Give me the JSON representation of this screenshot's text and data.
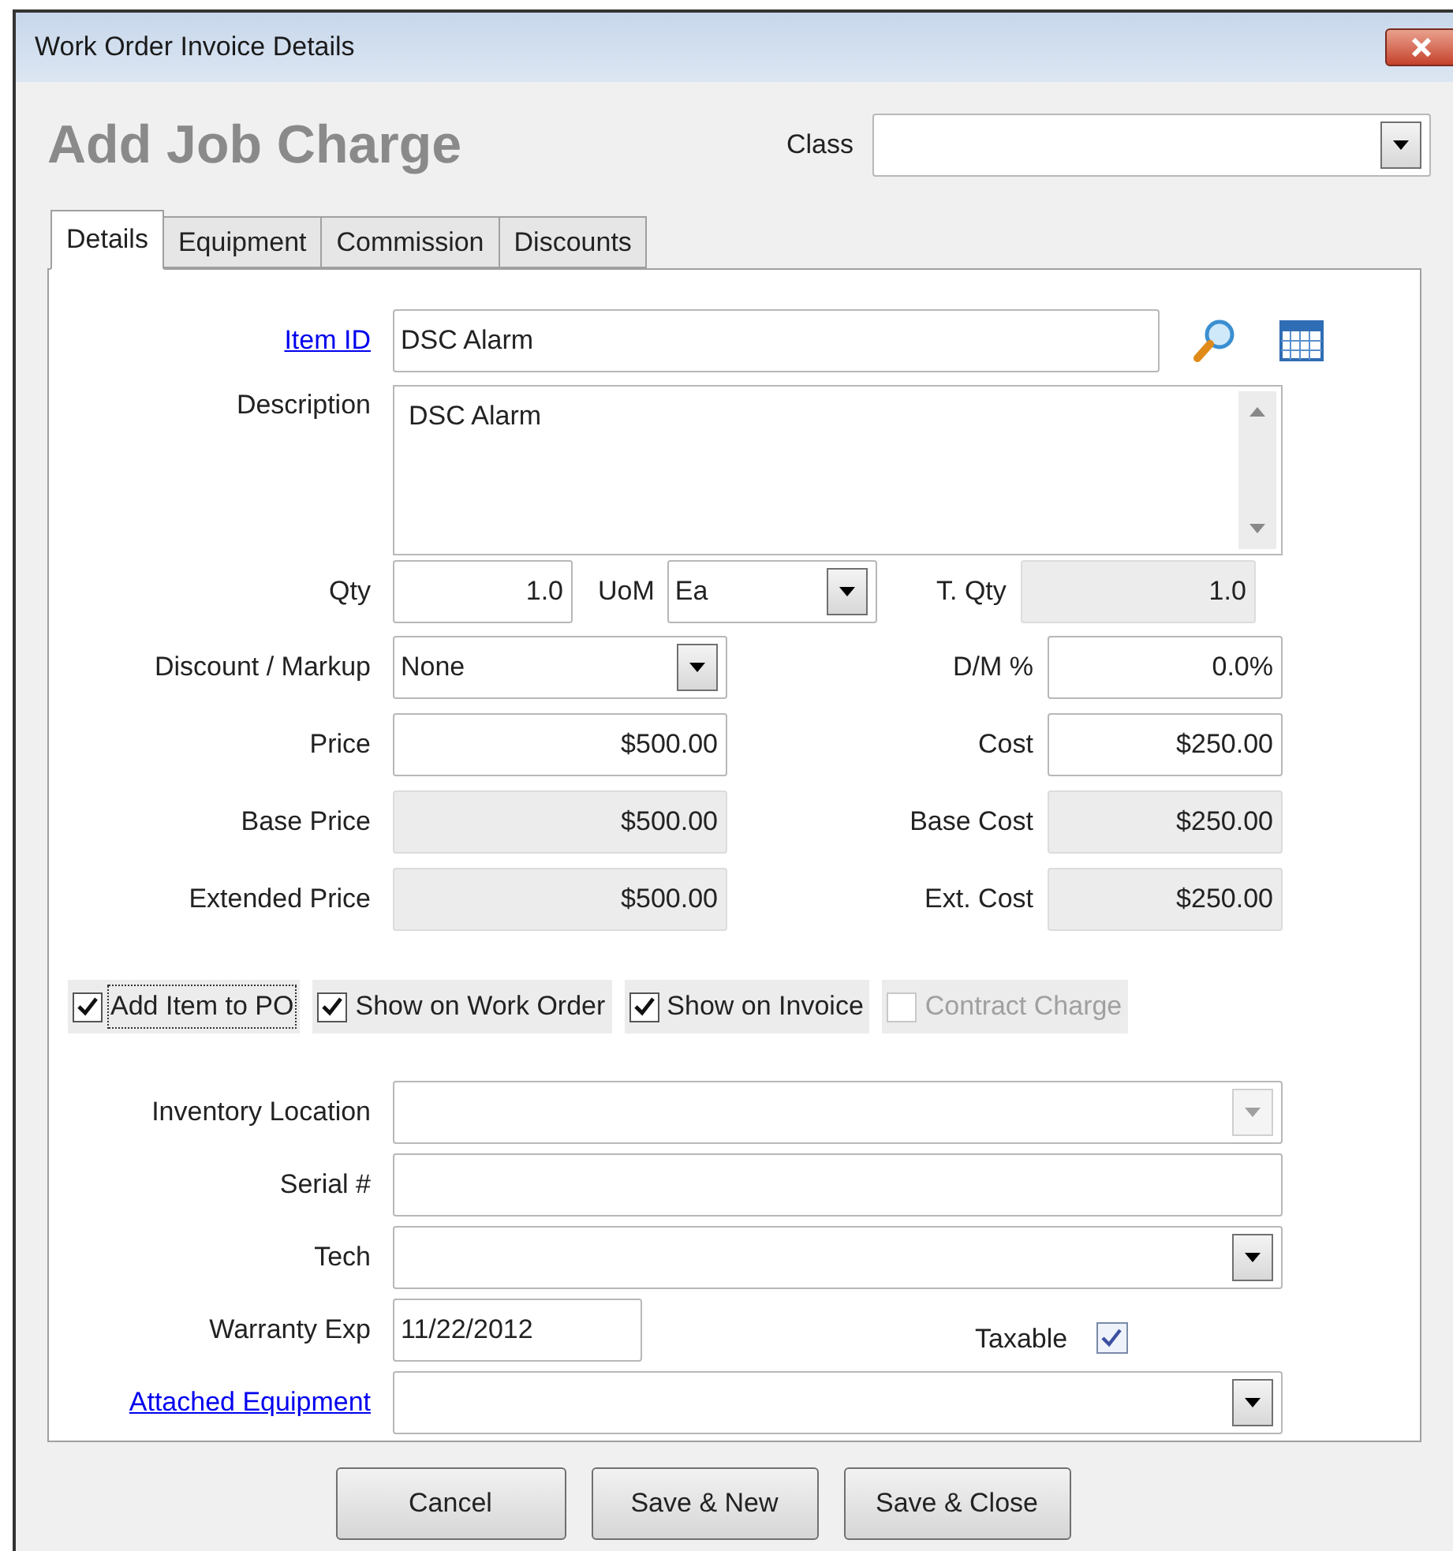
{
  "window": {
    "title": "Work Order Invoice Details"
  },
  "header": {
    "title": "Add Job Charge",
    "class_field": {
      "label": "Class"
    }
  },
  "tabs": [
    {
      "label": "Details",
      "selected": true
    },
    {
      "label": "Equipment",
      "selected": false
    },
    {
      "label": "Commission",
      "selected": false
    },
    {
      "label": "Discounts",
      "selected": false
    }
  ],
  "item_id": {
    "label": "Item ID",
    "value": "DSC Alarm"
  },
  "description": {
    "label": "Description",
    "value": "DSC Alarm"
  },
  "qty": {
    "label": "Qty",
    "value": "1.0"
  },
  "uom": {
    "label": "UoM",
    "value": "Ea"
  },
  "t_qty": {
    "label": "T. Qty",
    "value": "1.0",
    "disabled": true
  },
  "pairs": [
    {
      "left": {
        "label": "Discount / Markup",
        "value": "None",
        "kind": "dropdown",
        "disabled": false
      },
      "right": {
        "label": "D/M %",
        "value": "0.0%",
        "disabled": false
      }
    },
    {
      "left": {
        "label": "Price",
        "value": "$500.00",
        "kind": "text",
        "disabled": false
      },
      "right": {
        "label": "Cost",
        "value": "$250.00",
        "disabled": false
      }
    },
    {
      "left": {
        "label": "Base Price",
        "value": "$500.00",
        "kind": "text",
        "disabled": true
      },
      "right": {
        "label": "Base Cost",
        "value": "$250.00",
        "disabled": true
      }
    },
    {
      "left": {
        "label": "Extended Price",
        "value": "$500.00",
        "kind": "text",
        "disabled": true
      },
      "right": {
        "label": "Ext. Cost",
        "value": "$250.00",
        "disabled": true
      }
    }
  ],
  "checkboxes": [
    {
      "label": "Add Item to PO",
      "checked": true,
      "disabled": false,
      "focused": true
    },
    {
      "label": "Show on Work Order",
      "checked": true,
      "disabled": false,
      "focused": false
    },
    {
      "label": "Show on Invoice",
      "checked": true,
      "disabled": false,
      "focused": false
    },
    {
      "label": "Contract Charge",
      "checked": false,
      "disabled": true,
      "focused": false
    }
  ],
  "inventory_location": {
    "label": "Inventory Location",
    "disabled": true
  },
  "serial": {
    "label": "Serial #"
  },
  "tech": {
    "label": "Tech"
  },
  "warranty_exp": {
    "label": "Warranty Exp",
    "value": "11/22/2012"
  },
  "taxable": {
    "label": "Taxable",
    "checked": true
  },
  "attached_equipment": {
    "label": "Attached Equipment"
  },
  "buttons": [
    "Cancel",
    "Save & New",
    "Save & Close"
  ]
}
